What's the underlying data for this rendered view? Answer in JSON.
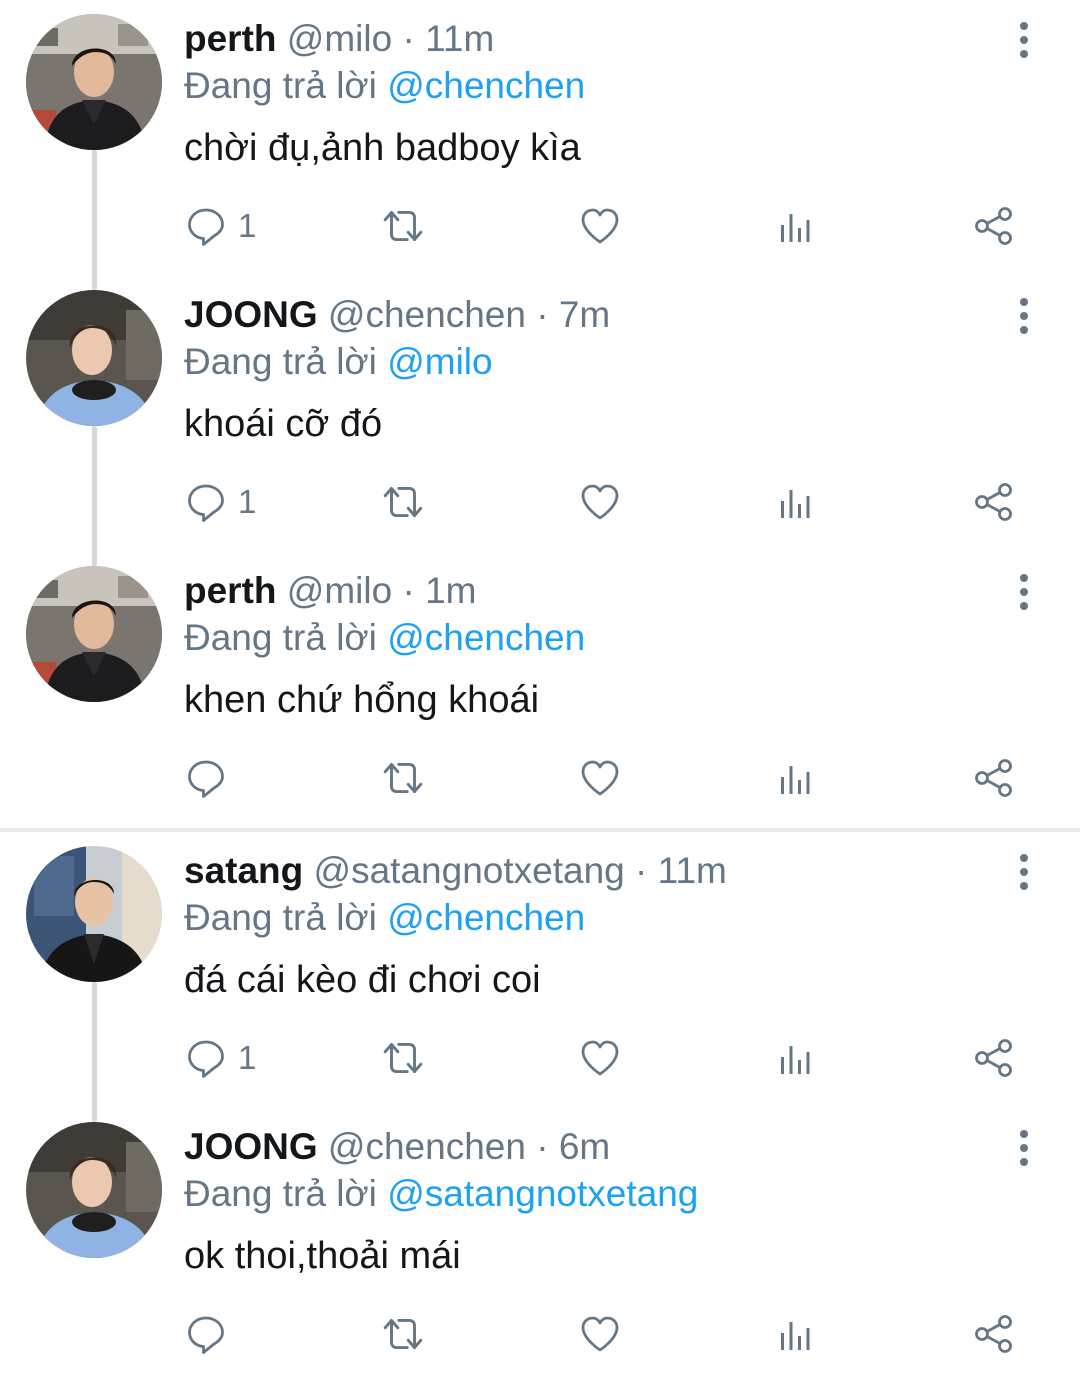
{
  "colors": {
    "text": "#14171a",
    "secondary": "#657786",
    "mention": "#1da1f2",
    "thread_line": "#d4d9de",
    "divider": "#e6ecf0"
  },
  "icons": {
    "reply": "speech-bubble-icon",
    "retweet": "retweet-arrows-icon",
    "like": "heart-icon",
    "stats": "bar-chart-icon",
    "share": "share-nodes-icon",
    "more": "vertical-ellipsis-icon"
  },
  "tweets": [
    {
      "name": "perth",
      "handle": "@milo",
      "sep": "·",
      "time": "11m",
      "reply_prefix": "Đang trả lời",
      "reply_to": "@chenchen",
      "text": "chời đụ,ảnh badboy kìa",
      "reply_count": "1"
    },
    {
      "name": "JOONG",
      "handle": "@chenchen",
      "sep": "·",
      "time": "7m",
      "reply_prefix": "Đang trả lời",
      "reply_to": "@milo",
      "text": "khoái cỡ đó",
      "reply_count": "1"
    },
    {
      "name": "perth",
      "handle": "@milo",
      "sep": "·",
      "time": "1m",
      "reply_prefix": "Đang trả lời",
      "reply_to": "@chenchen",
      "text": "khen chứ hổng khoái",
      "reply_count": ""
    },
    {
      "name": "satang",
      "handle": "@satangnotxetang",
      "sep": "·",
      "time": "11m",
      "reply_prefix": "Đang trả lời",
      "reply_to": "@chenchen",
      "text": "đá cái kèo đi chơi coi",
      "reply_count": "1"
    },
    {
      "name": "JOONG",
      "handle": "@chenchen",
      "sep": "·",
      "time": "6m",
      "reply_prefix": "Đang trả lời",
      "reply_to": "@satangnotxetang",
      "text": "ok thoi,thoải mái",
      "reply_count": ""
    }
  ]
}
